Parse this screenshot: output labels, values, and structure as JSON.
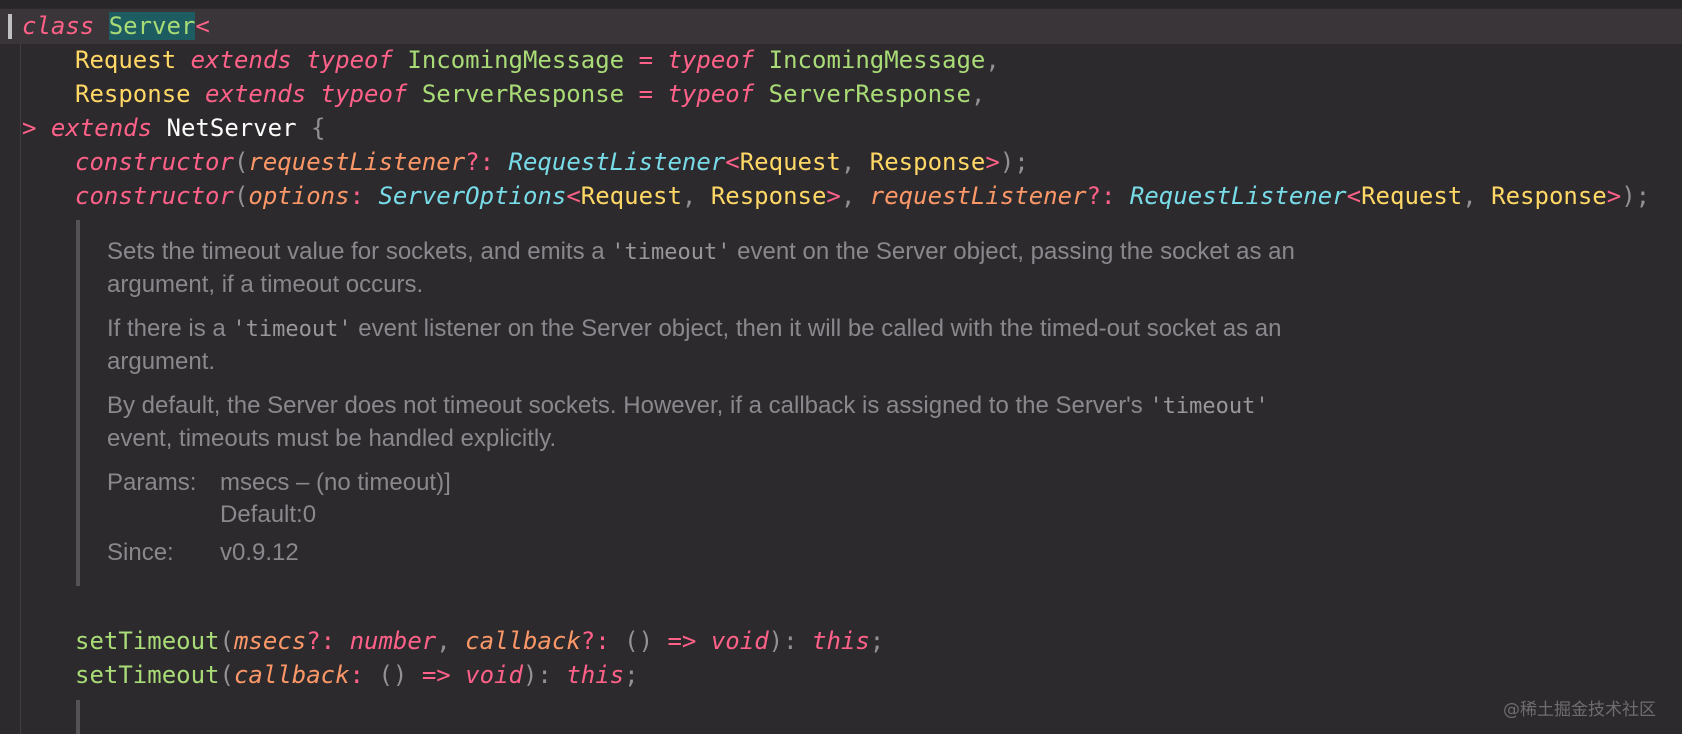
{
  "colors": {
    "background": "#2d2a2e",
    "keyword": "#ff6188",
    "class_name": "#a9dc76",
    "type_param": "#ffd866",
    "parameter": "#fc9867",
    "interface": "#78dce8",
    "doc_text": "#8b888d"
  },
  "code": {
    "line1": {
      "kw_class": "class",
      "class_name": "Server",
      "open": "<"
    },
    "line2": {
      "name": "Request",
      "kw_extends": "extends",
      "kw_typeof": "typeof",
      "type": "IncomingMessage",
      "eq": "=",
      "kw_typeof2": "typeof",
      "type2": "IncomingMessage",
      "comma": ","
    },
    "line3": {
      "name": "Response",
      "kw_extends": "extends",
      "kw_typeof": "typeof",
      "type": "ServerResponse",
      "eq": "=",
      "kw_typeof2": "typeof",
      "type2": "ServerResponse",
      "comma": ","
    },
    "line4": {
      "close": ">",
      "kw_extends": "extends",
      "base": "NetServer",
      "brace": "{"
    },
    "line5": {
      "kw_ctor": "constructor",
      "paren_open": "(",
      "param": "requestListener",
      "opt": "?:",
      "iface": "RequestListener",
      "lt": "<",
      "t1": "Request",
      "comma": ",",
      "t2": "Response",
      "gt": ">",
      "end": ");"
    },
    "line6": {
      "kw_ctor": "constructor",
      "paren_open": "(",
      "param1": "options",
      "colon": ":",
      "iface1": "ServerOptions",
      "lt1": "<",
      "t1": "Request",
      "comma1": ",",
      "t2": "Response",
      "gt1": ">",
      "comma2": ",",
      "param2": "requestListener",
      "opt": "?:",
      "iface2": "RequestListener",
      "lt2": "<",
      "t3": "Request",
      "comma3": ",",
      "t4": "Response",
      "gt2": ">",
      "end": ");"
    },
    "line7": {
      "fn": "setTimeout",
      "paren_open": "(",
      "param1": "msecs",
      "opt1": "?:",
      "type1": "number",
      "comma": ",",
      "param2": "callback",
      "opt2": "?:",
      "fnsig": "()",
      "arrow": "=>",
      "void": "void",
      "close": "):",
      "this": "this",
      "semi": ";"
    },
    "line8": {
      "fn": "setTimeout",
      "paren_open": "(",
      "param": "callback",
      "colon": ":",
      "fnsig": "()",
      "arrow": "=>",
      "void": "void",
      "close": "):",
      "this": "this",
      "semi": ";"
    }
  },
  "doc": {
    "p1_a": "Sets the timeout value for sockets, and emits a ",
    "p1_code": "'timeout'",
    "p1_b": " event on the Server object, passing the socket as an argument, if a timeout occurs.",
    "p2_a": "If there is a ",
    "p2_code": "'timeout'",
    "p2_b": " event listener on the Server object, then it will be called with the timed-out socket as an argument.",
    "p3_a": "By default, the Server does not timeout sockets. However, if a callback is assigned to the Server's ",
    "p3_code": "'timeout'",
    "p3_b": " event, timeouts must be handled explicitly.",
    "params_label": "Params:",
    "params_value": "msecs – (no timeout)]",
    "params_default": "Default:0",
    "since_label": "Since:",
    "since_value": "v0.9.12"
  },
  "watermark": "@稀土掘金技术社区"
}
